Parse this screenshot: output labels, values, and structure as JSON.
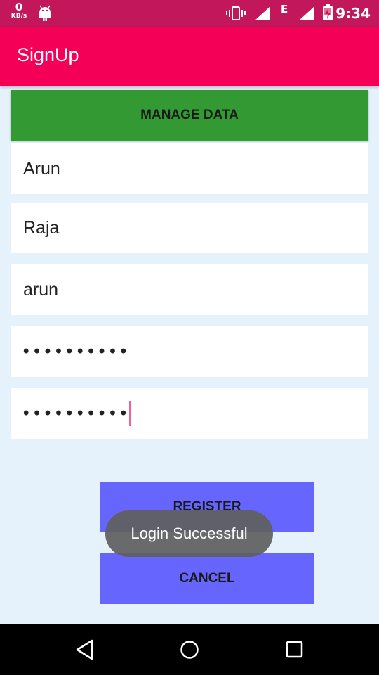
{
  "status_bar": {
    "net_speed_value": "0",
    "net_speed_unit": "KB/s",
    "network_type": "E",
    "time": "9:34",
    "icons": [
      "android-icon",
      "vibrate-icon",
      "signal-icon",
      "signal-icon",
      "battery-charging-icon"
    ]
  },
  "app_bar": {
    "title": "SignUp",
    "color": "#f50057"
  },
  "manage_button": {
    "label": "MANAGE DATA",
    "color": "#339933"
  },
  "form": {
    "first_name": "Arun",
    "last_name": "Raja",
    "username": "arun",
    "password": "••••••••••",
    "confirm_password": "••••••••••"
  },
  "register_button": {
    "label": "REGISTER",
    "color": "#6666ff"
  },
  "cancel_button": {
    "label": "CANCEL",
    "color": "#6666ff"
  },
  "toast": {
    "message": "Login Successful"
  },
  "nav_bar": {
    "icons": [
      "back-icon",
      "home-icon",
      "recents-icon"
    ]
  }
}
